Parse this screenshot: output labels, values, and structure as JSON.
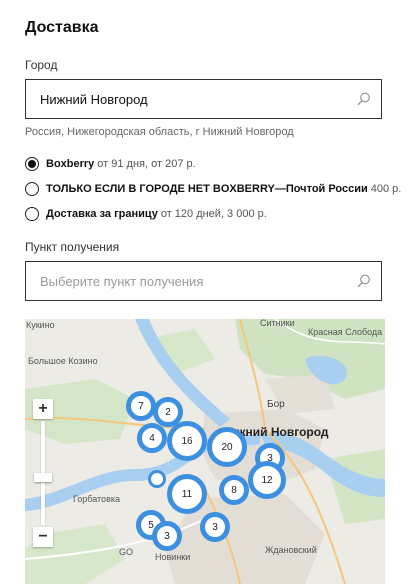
{
  "heading": "Доставка",
  "city": {
    "label": "Город",
    "value": "Нижний Новгород",
    "hint": "Россия, Нижегородская область, г Нижний Новгород"
  },
  "delivery_options": [
    {
      "name": "Boxberry",
      "detail": "от 91 дня, от 207 р.",
      "selected": true
    },
    {
      "name": "ТОЛЬКО ЕСЛИ В ГОРОДЕ НЕТ BOXBERRY—Почтой России",
      "detail": "400 р.",
      "selected": false
    },
    {
      "name": "Доставка за границу",
      "detail": "от 120 дней, 3 000 р.",
      "selected": false
    }
  ],
  "pickup": {
    "label": "Пункт получения",
    "placeholder": "Выберите пункт получения"
  },
  "map": {
    "labels": {
      "kukino": "Кукино",
      "sitniki": "Ситники",
      "krasnaya_sloboda": "Красная Слобода",
      "bolshoe_kozino": "Большое Козино",
      "bor": "Бор",
      "nizhny": "Нижний Новгород",
      "gorbatovka": "Горбатовка",
      "novinki": "Новинки",
      "zhdanovsky": "Ждановский",
      "go": "GO"
    },
    "clusters": [
      "7",
      "2",
      "4",
      "16",
      "20",
      "3",
      "12",
      "",
      "11",
      "8",
      "5",
      "3",
      "3"
    ],
    "zoom": {
      "in": "+",
      "out": "−",
      "handle": ":::"
    }
  },
  "colors": {
    "cluster": "#3d8fe0",
    "water": "#a9cff0"
  }
}
